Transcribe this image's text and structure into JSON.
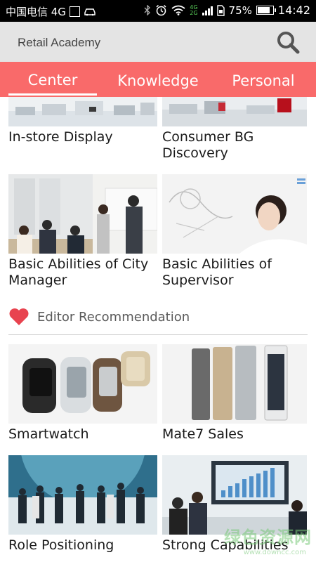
{
  "status_bar": {
    "carrier": "中国电信 4G",
    "network_top": "4G",
    "network_bottom": "2G",
    "battery": "75%",
    "battery_level": 0.75,
    "time": "14:42"
  },
  "header": {
    "title": "Retail Academy",
    "search_icon": "search-icon"
  },
  "tabs": [
    {
      "label": "Center",
      "active": true
    },
    {
      "label": "Knowledge",
      "active": false
    },
    {
      "label": "Personal",
      "active": false
    }
  ],
  "courses_top": [
    {
      "label": "In-store Display"
    },
    {
      "label": "Consumer BG Discovery"
    },
    {
      "label": "Basic Abilities of City Manager"
    },
    {
      "label": "Basic Abilities of Supervisor"
    }
  ],
  "section": {
    "title": "Editor Recommendation",
    "icon": "heart-icon"
  },
  "recommendations": [
    {
      "label": "Smartwatch"
    },
    {
      "label": "Mate7 Sales"
    },
    {
      "label": "Role Positioning"
    },
    {
      "label": "Strong Capabilities"
    }
  ],
  "watermark": {
    "text": "绿色资源网",
    "sub": "www.downcc.com"
  },
  "colors": {
    "accent": "#f96a6a",
    "header_bg": "#e4e4e4",
    "heart": "#e8434f"
  }
}
